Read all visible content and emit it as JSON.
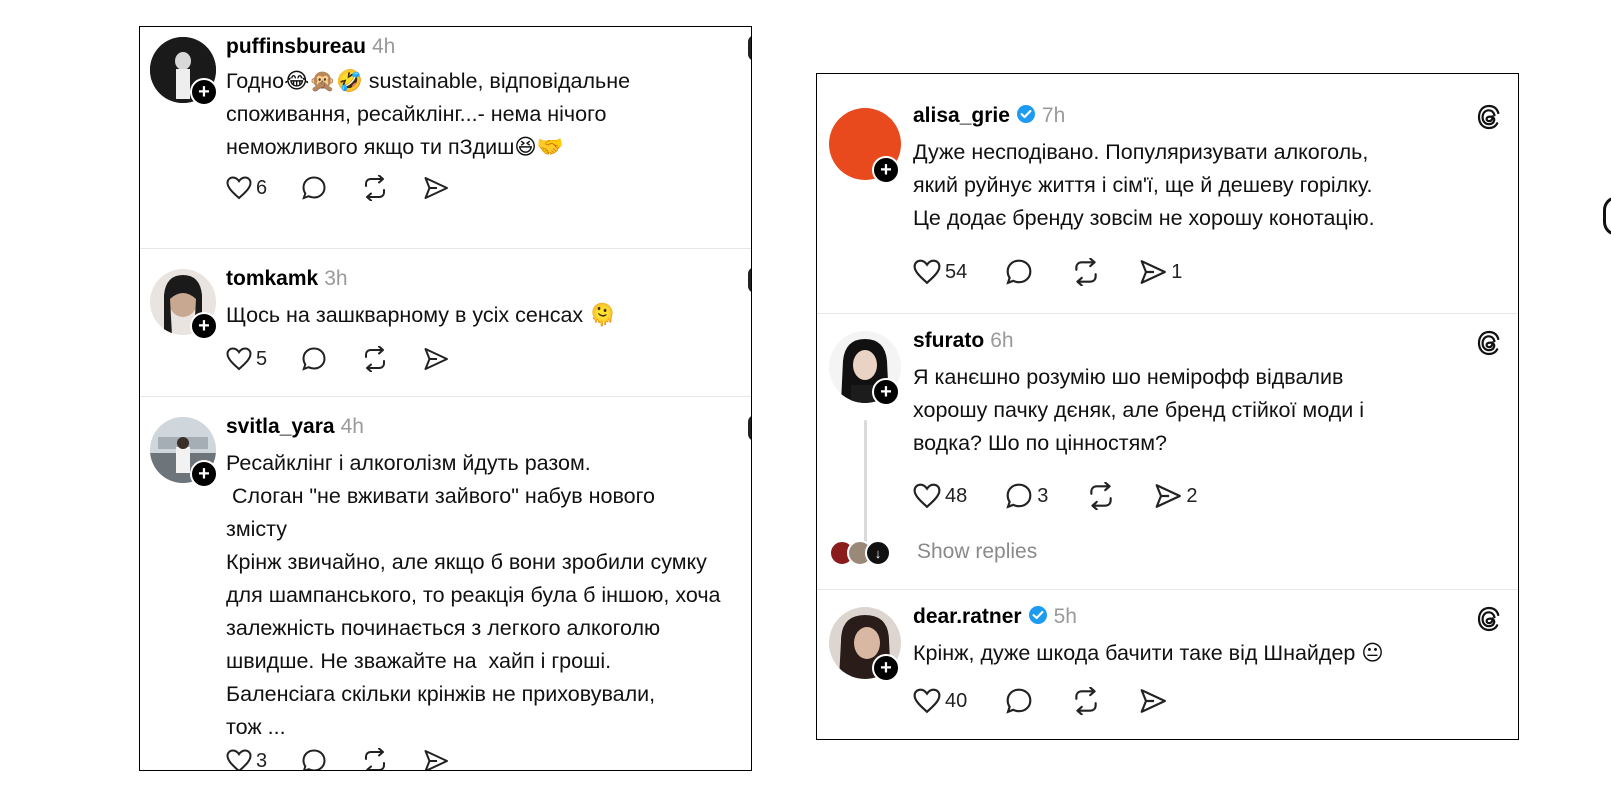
{
  "left_panel": {
    "posts": [
      {
        "username": "puffinsbureau",
        "time": "4h",
        "lines": [
          "Годно😂🙊🤣 sustainable, відповідальне",
          "споживання, ресайклінг...- нема нічого",
          "неможливого якщо ти пЗдиш😆🤝"
        ],
        "likes": "6",
        "comments": "",
        "reposts": "",
        "shares": ""
      },
      {
        "username": "tomkamk",
        "time": "3h",
        "lines": [
          "Щось на зашкварному в усіх сенсах 🫠"
        ],
        "likes": "5",
        "comments": "",
        "reposts": "",
        "shares": ""
      },
      {
        "username": "svitla_yara",
        "time": "4h",
        "lines": [
          "Ресайклінг і алкоголізм йдуть разом.",
          " Слоган \"не вживати зайвого\" набув нового",
          "змісту",
          "Крінж звичайно, але якщо б вони зробили сумку",
          "для шампанського, то реакція була б іншою, хоча",
          "залежність починається з легкого алкоголю",
          "швидше. Не зважайте на  хайп і гроші.",
          "Баленсіага скільки крінжів не приховували,",
          "тож ..."
        ],
        "likes": "3",
        "comments": "",
        "reposts": "",
        "shares": ""
      }
    ]
  },
  "right_panel": {
    "posts": [
      {
        "username": "alisa_grie",
        "verified": true,
        "time": "7h",
        "lines": [
          "Дуже несподівано. Популяризувати алкоголь,",
          "який руйнує життя і сім'ї, ще й дешеву горілку.",
          "Це додає бренду зовсім не хорошу конотацію."
        ],
        "likes": "54",
        "comments": "",
        "reposts": "",
        "shares": "1",
        "avatar_color": "#e8491d"
      },
      {
        "username": "sfurato",
        "verified": false,
        "time": "6h",
        "lines": [
          "Я канєшно розумію шо немірофф відвалив",
          "хорошу пачку дєняк, але бренд стійкої моди і",
          "водка? Шо по цінностям?"
        ],
        "likes": "48",
        "comments": "3",
        "reposts": "",
        "shares": "2"
      },
      {
        "username": "dear.ratner",
        "verified": true,
        "time": "5h",
        "lines": [
          "Крінж, дуже шкода бачити таке від Шнайдер 😐"
        ],
        "likes": "40",
        "comments": "",
        "reposts": "",
        "shares": ""
      }
    ],
    "show_replies_label": "Show replies"
  },
  "colors": {
    "verified_blue": "#1d9bf0",
    "muted_gray": "#9a9a9a",
    "divider": "#e6e6e6"
  },
  "icons": [
    "heart-icon",
    "comment-icon",
    "repost-icon",
    "share-icon",
    "threads-logo-icon",
    "verified-badge-icon",
    "follow-plus-icon"
  ]
}
